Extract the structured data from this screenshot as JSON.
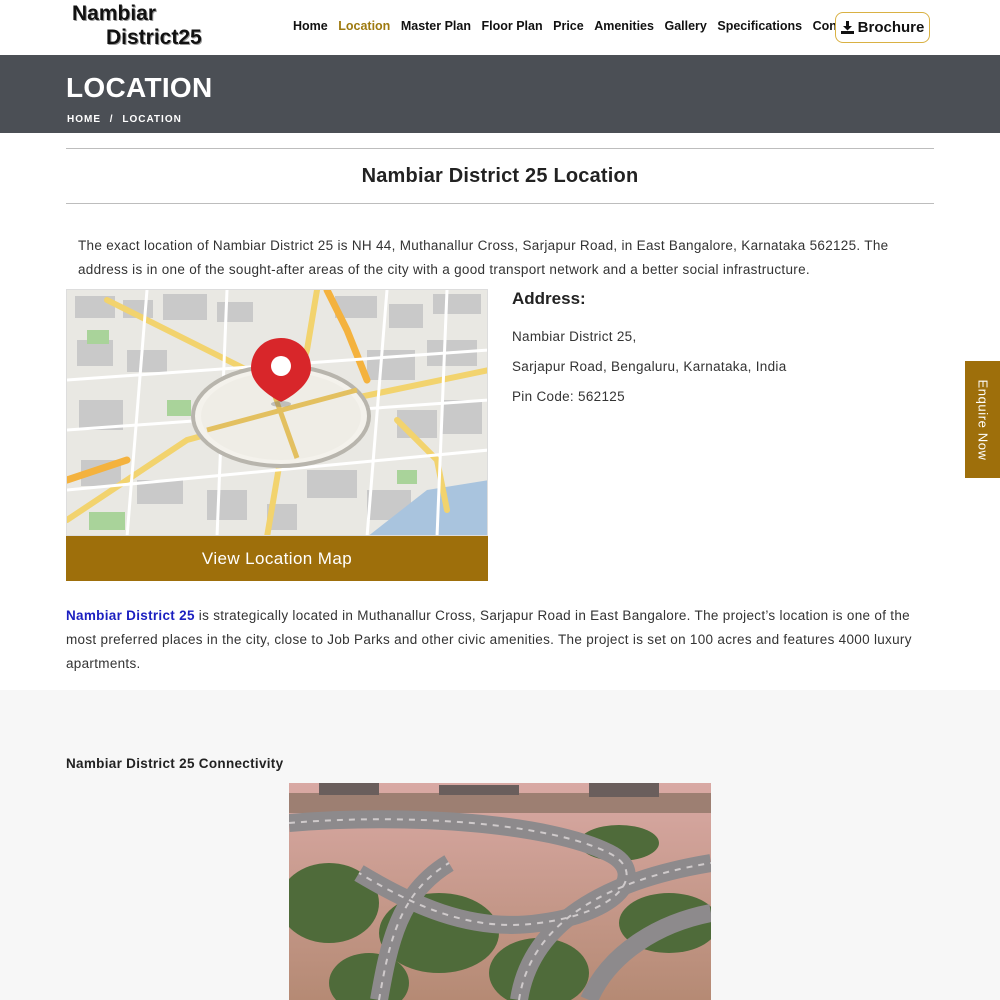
{
  "logo": {
    "line1": "Nambiar",
    "line2": "District25"
  },
  "nav": {
    "items": [
      "Home",
      "Location",
      "Master Plan",
      "Floor Plan",
      "Price",
      "Amenities",
      "Gallery",
      "Specifications",
      "Contact"
    ],
    "active": "Location",
    "brochure_label": "Brochure"
  },
  "banner": {
    "title": "LOCATION",
    "breadcrumb_home": "HOME",
    "breadcrumb_sep": "/",
    "breadcrumb_current": "LOCATION"
  },
  "section": {
    "title": "Nambiar District 25 Location",
    "intro": "The exact location of Nambiar District 25 is NH 44, Muthanallur Cross, Sarjapur Road, in East Bangalore, Karnataka 562125. The address is in one of the sought-after areas of the city with a good transport network and a better social infrastructure."
  },
  "map": {
    "button_label": "View Location Map"
  },
  "address": {
    "heading": "Address:",
    "line1": "Nambiar District 25,",
    "line2": "Sarjapur Road, Bengaluru, Karnataka, India",
    "line3": "Pin Code: 562125"
  },
  "summary": {
    "brand": "Nambiar District 25",
    "text": " is strategically located in Muthanallur Cross, Sarjapur Road in East Bangalore. The project’s location is one of the most preferred places in the city, close to Job Parks and other civic amenities. The project is set on 100 acres and features 4000 luxury apartments."
  },
  "connectivity": {
    "title": "Nambiar District 25 Connectivity"
  },
  "enquire": {
    "label": "Enquire Now"
  },
  "colors": {
    "accent": "#9e6f0b",
    "active_nav": "#9e7a0f",
    "banner": "#4b4f55",
    "link": "#1b1fc0"
  }
}
